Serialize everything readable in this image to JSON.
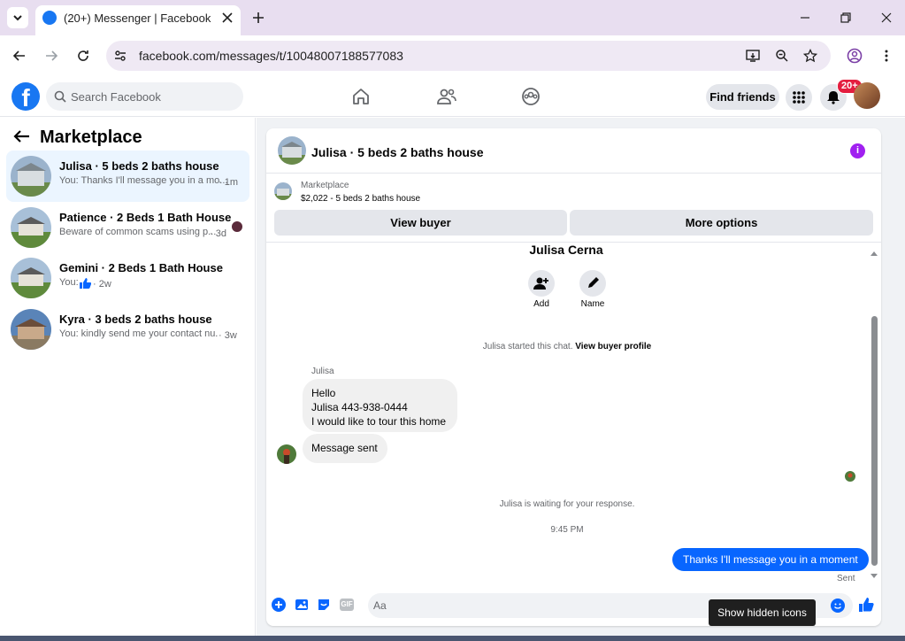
{
  "browser": {
    "tab_title": "(20+) Messenger | Facebook",
    "url": "facebook.com/messages/t/10048007188577083"
  },
  "fb": {
    "search_placeholder": "Search Facebook",
    "find_friends": "Find friends",
    "notif_badge": "20+"
  },
  "left": {
    "title": "Marketplace",
    "conversations": [
      {
        "name": "Julisa · 5 beds 2 baths house",
        "snippet": "You: Thanks I'll message you in a mo...",
        "time": "· 1m",
        "active": true
      },
      {
        "name": "Patience · 2 Beds 1 Bath House",
        "snippet": "Beware of common scams using p...",
        "time": "· 3d",
        "active": false
      },
      {
        "name": "Gemini · 2 Beds 1 Bath House",
        "snippet": "You: ",
        "time": "· 2w",
        "active": false
      },
      {
        "name": "Kyra · 3 beds 2 baths house",
        "snippet": "You: kindly send me your contact nu...",
        "time": "· 3w",
        "active": false
      }
    ]
  },
  "chat": {
    "title": "Julisa · 5 beds 2 baths house",
    "marketplace_label": "Marketplace",
    "listing": "$2,022 - 5 beds 2 baths house",
    "view_buyer": "View buyer",
    "more_options": "More options",
    "person_name": "Julisa Cerna",
    "add_label": "Add",
    "name_label": "Name",
    "started_text": "Julisa started this chat.",
    "view_buyer_profile": "View buyer profile",
    "from_name": "Julisa",
    "msg_lines": [
      "Hello",
      "Julisa 443-938-0444",
      "I would like to tour this home"
    ],
    "msg2": "Message sent",
    "waiting": "Julisa is waiting for your response.",
    "time": "9:45 PM",
    "outgoing": "Thanks I'll message you in a moment",
    "sent": "Sent",
    "composer_placeholder": "Aa",
    "gif": "GIF"
  },
  "tooltip": "Show hidden icons",
  "colors": {
    "fb_blue": "#1877f2",
    "bubble_out": "#0866ff",
    "accent_purple": "#a020f0",
    "badge_red": "#e41e3f"
  }
}
